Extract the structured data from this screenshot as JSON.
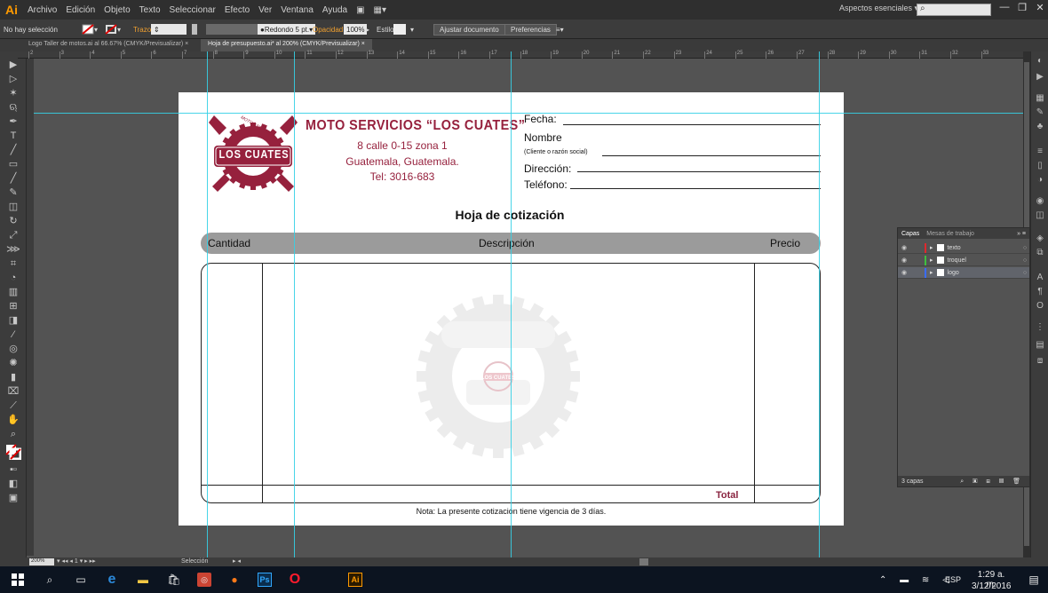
{
  "menubar": {
    "app_logo": "Ai",
    "items": [
      "Archivo",
      "Edición",
      "Objeto",
      "Texto",
      "Seleccionar",
      "Efecto",
      "Ver",
      "Ventana",
      "Ayuda"
    ],
    "workspace": "Aspectos esenciales",
    "search_placeholder": ""
  },
  "controlbar": {
    "selection": "No hay selección",
    "stroke_label": "Trazo",
    "brush": "Redondo 5 pt.",
    "opacity_label": "Opacidad:",
    "opacity_value": "100%",
    "style_label": "Estilo:",
    "fit_button": "Ajustar documento",
    "prefs_button": "Preferencias"
  },
  "tabs": [
    {
      "label": "Logo Taller de motos.ai al 66.67% (CMYK/Previsualizar)"
    },
    {
      "label": "Hoja de presupuesto.ai* al 200% (CMYK/Previsualizar)"
    }
  ],
  "ruler": [
    "2",
    "3",
    "4",
    "5",
    "6",
    "7",
    "8",
    "9",
    "10",
    "11",
    "12",
    "13",
    "14",
    "15",
    "16",
    "17",
    "18",
    "19",
    "20",
    "21",
    "22",
    "23",
    "24",
    "25",
    "26",
    "27",
    "28",
    "29",
    "30",
    "31",
    "32",
    "33"
  ],
  "document": {
    "company_name": "MOTO SERVICIOS “LOS CUATES”",
    "address": "8 calle 0-15 zona 1",
    "city": "Guatemala, Guatemala.",
    "phone": "Tel: 3016-683",
    "logo_top_text": "MOTO SERVICIOS",
    "logo_main_text": "LOS CUATES",
    "fields": {
      "fecha": "Fecha:",
      "nombre": "Nombre",
      "cliente": "(Cliente o razón social)",
      "direccion": "Dirección:",
      "telefono": "Teléfono:"
    },
    "title": "Hoja de cotización",
    "columns": {
      "cantidad": "Cantidad",
      "descripcion": "Descripción",
      "precio": "Precio"
    },
    "total_label": "Total",
    "note": "Nota: La presente cotización tiene vigencia de 3 días."
  },
  "layers_panel": {
    "tabs": [
      "Capas",
      "Mesas de trabajo"
    ],
    "layers": [
      {
        "name": "texto",
        "color": "#e0282d"
      },
      {
        "name": "troquel",
        "color": "#3fbf3f"
      },
      {
        "name": "logo",
        "color": "#3a6cff"
      }
    ],
    "count_label": "3 capas"
  },
  "statusbar": {
    "zoom": "200%",
    "tool": "Selección"
  },
  "taskbar": {
    "language": "ESP",
    "time": "1:29 a. m.",
    "date": "3/12/2016"
  },
  "colors": {
    "brand": "#96213d",
    "guide": "#35d0e6",
    "header_bar": "#9b9b9b"
  }
}
